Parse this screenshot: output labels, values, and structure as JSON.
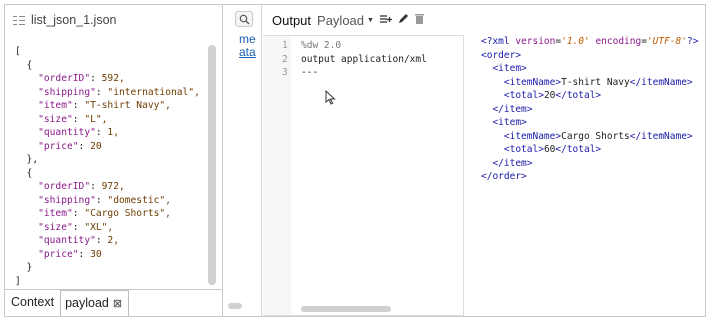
{
  "left_panel": {
    "title": "list_json_1.json",
    "json_lines": [
      {
        "text": "["
      },
      {
        "text": "  {"
      },
      {
        "key": "\"orderID\"",
        "val": " 592,"
      },
      {
        "key": "\"shipping\"",
        "val": " \"international\","
      },
      {
        "key": "\"item\"",
        "val": " \"T-shirt Navy\","
      },
      {
        "key": "\"size\"",
        "val": " \"L\","
      },
      {
        "key": "\"quantity\"",
        "val": " 1,"
      },
      {
        "key": "\"price\"",
        "val": " 20"
      },
      {
        "text": "  },"
      },
      {
        "text": "  {"
      },
      {
        "key": "\"orderID\"",
        "val": " 972,"
      },
      {
        "key": "\"shipping\"",
        "val": " \"domestic\","
      },
      {
        "key": "\"item\"",
        "val": " \"Cargo Shorts\","
      },
      {
        "key": "\"size\"",
        "val": " \"XL\","
      },
      {
        "key": "\"quantity\"",
        "val": " 2,"
      },
      {
        "key": "\"price\"",
        "val": " 30"
      },
      {
        "text": "  }"
      },
      {
        "text": "]"
      }
    ],
    "tabs": {
      "context": "Context",
      "payload": "payload",
      "payload_close": "⊠"
    }
  },
  "middle_panel": {
    "link_top": "me",
    "link_bottom": "ata"
  },
  "right_panel": {
    "output_label": "Output",
    "payload_label": "Payload",
    "icons": [
      "add-rows-icon",
      "pencil-icon",
      "trash-icon"
    ]
  },
  "script": {
    "line_numbers": [
      "1",
      "2",
      "3"
    ],
    "lines": [
      "%dw 2.0",
      "output application/xml",
      "---"
    ]
  },
  "xml_output": {
    "declaration": {
      "open": "<?xml ",
      "attr1": "version",
      "val1": "'1.0'",
      "attr2": "encoding",
      "val2": "'UTF-8'",
      "close": "?>"
    },
    "lines": [
      {
        "indent": "",
        "open": "<order>"
      },
      {
        "indent": "  ",
        "open": "<item>"
      },
      {
        "indent": "    ",
        "open": "<itemName>",
        "text": "T-shirt Navy",
        "close": "</itemName>"
      },
      {
        "indent": "    ",
        "open": "<total>",
        "text": "20",
        "close": "</total>"
      },
      {
        "indent": "  ",
        "open": "</item>"
      },
      {
        "indent": "  ",
        "open": "<item>"
      },
      {
        "indent": "    ",
        "open": "<itemName>",
        "text": "Cargo Shorts",
        "close": "</itemName>"
      },
      {
        "indent": "    ",
        "open": "<total>",
        "text": "60",
        "close": "</total>"
      },
      {
        "indent": "  ",
        "open": "</item>"
      },
      {
        "indent": "",
        "open": "</order>"
      }
    ]
  },
  "colors": {
    "xml_tag": "#1a1aa8",
    "xml_attr": "#8b1a8b",
    "xml_value": "#c05a00",
    "link": "#1a5fb4"
  }
}
